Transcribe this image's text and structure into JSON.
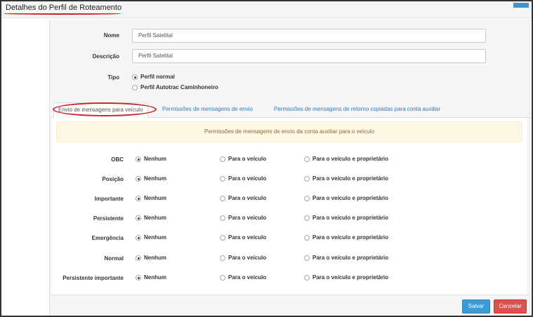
{
  "header": {
    "title": "Detalhes do Perfil de Roteamento"
  },
  "form": {
    "name": {
      "label": "Nome",
      "value": "Perfil Satelital"
    },
    "description": {
      "label": "Descrição",
      "value": "Perfil Satelital"
    },
    "type": {
      "label": "Tipo",
      "options": [
        {
          "label": "Perfil normal",
          "checked": true
        },
        {
          "label": "Perfil Autotrac Caminhoneiro",
          "checked": false
        }
      ]
    }
  },
  "tabs": [
    {
      "label": "Envio de mensagens para veículo",
      "active": true
    },
    {
      "label": "Permissões de mensagens de envio",
      "active": false
    },
    {
      "label": "Permissões de mensagens de retorno copiadas para conta auxiliar",
      "active": false
    }
  ],
  "info": {
    "text": "Permissões de mensagens de envio da conta auxiliar para o veículo"
  },
  "options": {
    "none": "Nenhum",
    "vehicle": "Para o veículo",
    "vehicle_owner": "Para o veículo e proprietário"
  },
  "rows": [
    {
      "label": "OBC",
      "selected": "none"
    },
    {
      "label": "Posição",
      "selected": "none"
    },
    {
      "label": "Importante",
      "selected": "none"
    },
    {
      "label": "Persistente",
      "selected": "none"
    },
    {
      "label": "Emergência",
      "selected": "none"
    },
    {
      "label": "Normal",
      "selected": "none"
    },
    {
      "label": "Persistente importante",
      "selected": "none"
    }
  ],
  "buttons": {
    "save": "Salvar",
    "cancel": "Cancelar"
  },
  "colors": {
    "primary": "#3a9bd5",
    "danger": "#d9534f",
    "highlight": "#c9252c",
    "info_bg": "#fcf8e3"
  }
}
